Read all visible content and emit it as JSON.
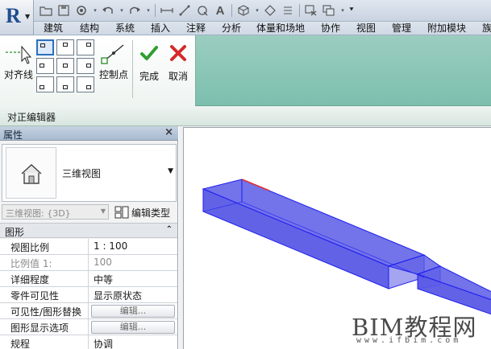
{
  "app": {
    "logo_letter": "R"
  },
  "qat": {
    "icons": [
      "open-icon",
      "save-icon",
      "sync-icon",
      "dropdown-arrow-icon",
      "undo-icon",
      "dropdown-arrow-icon",
      "redo-icon",
      "dropdown-arrow-icon",
      "measure-icon",
      "align-dimension-icon",
      "tag-icon",
      "text-icon",
      "view-3d-icon",
      "dropdown-arrow-icon",
      "section-icon",
      "thin-lines-icon",
      "close-hidden-windows-icon",
      "switch-windows-icon",
      "customize-dropdown-icon"
    ]
  },
  "ribbon_tabs": [
    "建筑",
    "结构",
    "系统",
    "插入",
    "注释",
    "分析",
    "体量和场地",
    "协作",
    "视图",
    "管理",
    "附加模块",
    "族"
  ],
  "ribbon": {
    "snap_label": "对齐线",
    "control_point_label": "控制点",
    "finish_label": "完成",
    "cancel_label": "取消",
    "finish_color": "#2e9e2e",
    "cancel_color": "#d42a2a"
  },
  "options_bar": {
    "title": "对正编辑器"
  },
  "properties": {
    "title": "属性",
    "close_glyph": "×",
    "type_name": "三维视图",
    "instance_selector": "三维视图: {3D}",
    "edit_type_label": "编辑类型",
    "group_title": "图形",
    "rows": [
      {
        "key": "视图比例",
        "value": "1 : 100",
        "dim": false,
        "button": false
      },
      {
        "key": "比例值 1:",
        "value": "100",
        "dim": true,
        "button": false
      },
      {
        "key": "详细程度",
        "value": "中等",
        "dim": false,
        "button": false
      },
      {
        "key": "零件可见性",
        "value": "显示原状态",
        "dim": false,
        "button": false
      },
      {
        "key": "可见性/图形替换",
        "value": "编辑...",
        "dim": false,
        "button": true
      },
      {
        "key": "图形显示选项",
        "value": "编辑...",
        "dim": false,
        "button": true
      },
      {
        "key": "规程",
        "value": "协调",
        "dim": false,
        "button": false
      }
    ]
  },
  "viewport": {
    "duct_fill": "#5a5ae6",
    "duct_edge": "#1e1ef0",
    "highlight_edge": "#e03030"
  },
  "watermark": {
    "main": "BIM教程网",
    "sub": "www.ifbim.com"
  }
}
